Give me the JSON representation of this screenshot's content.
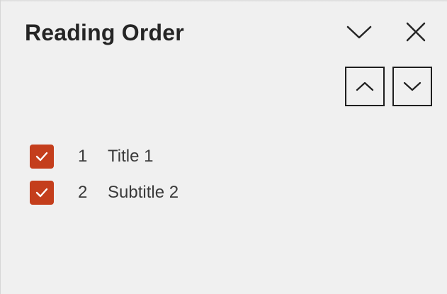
{
  "pane": {
    "title": "Reading Order",
    "collapse_icon": "chevron-down-icon",
    "close_icon": "close-icon"
  },
  "toolbar": {
    "move_up_icon": "chevron-up-icon",
    "move_down_icon": "chevron-down-icon"
  },
  "items": [
    {
      "number": "1",
      "label": "Title 1",
      "checked": true
    },
    {
      "number": "2",
      "label": "Subtitle 2",
      "checked": true
    }
  ],
  "colors": {
    "checkbox": "#c43e1c",
    "background": "#f0f0f0",
    "text": "#252525"
  }
}
